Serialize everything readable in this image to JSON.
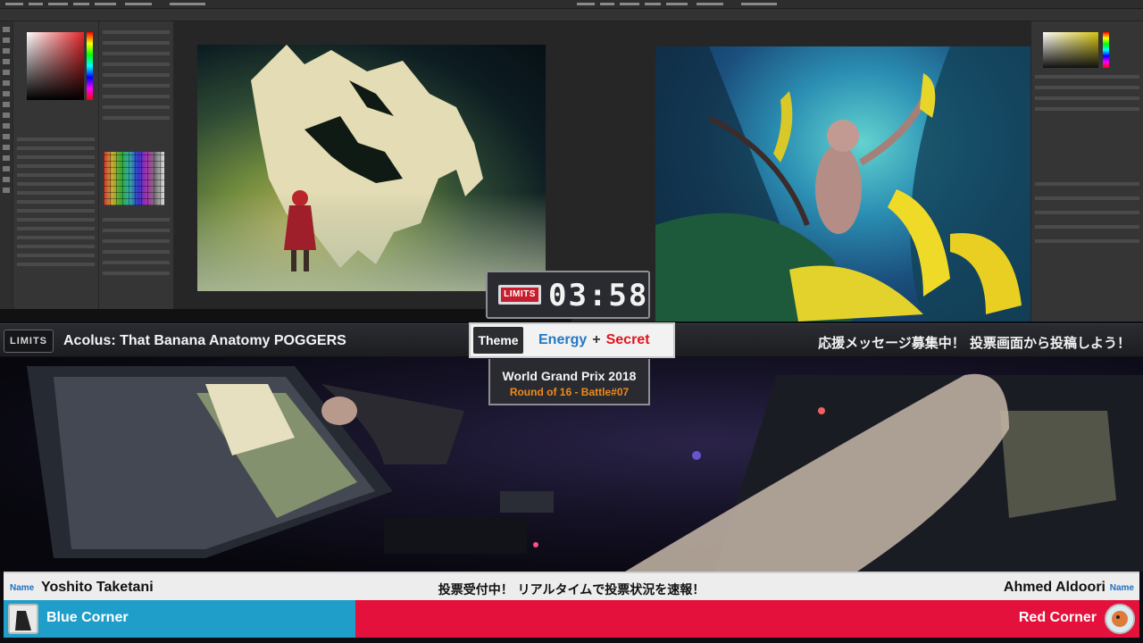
{
  "stream": {
    "logo_text": "LIMITS",
    "timer": "03:58",
    "title": "Acolus: That Banana Anatomy POGGERS",
    "cheer_message": "応援メッセージ募集中！ 投票画面から投稿しよう！",
    "theme": {
      "label": "Theme",
      "word1": "Energy",
      "plus": "+",
      "word2": "Secret"
    },
    "event": {
      "name": "World Grand Prix 2018",
      "round": "Round of 16 - Battle#07"
    }
  },
  "players": {
    "name_tag": "Name",
    "left": "Yoshito Taketani",
    "right": "Ahmed Aldoori"
  },
  "voting": {
    "message": "投票受付中！ リアルタイムで投票状況を速報！",
    "blue_label": "Blue Corner",
    "red_label": "Red Corner",
    "blue_share": 0.31
  },
  "colors": {
    "blue": "#1f9ec9",
    "red": "#e3113c",
    "theme_word1": "#2478c2",
    "theme_word2": "#e0151c",
    "round_text": "#ef8a1b"
  }
}
